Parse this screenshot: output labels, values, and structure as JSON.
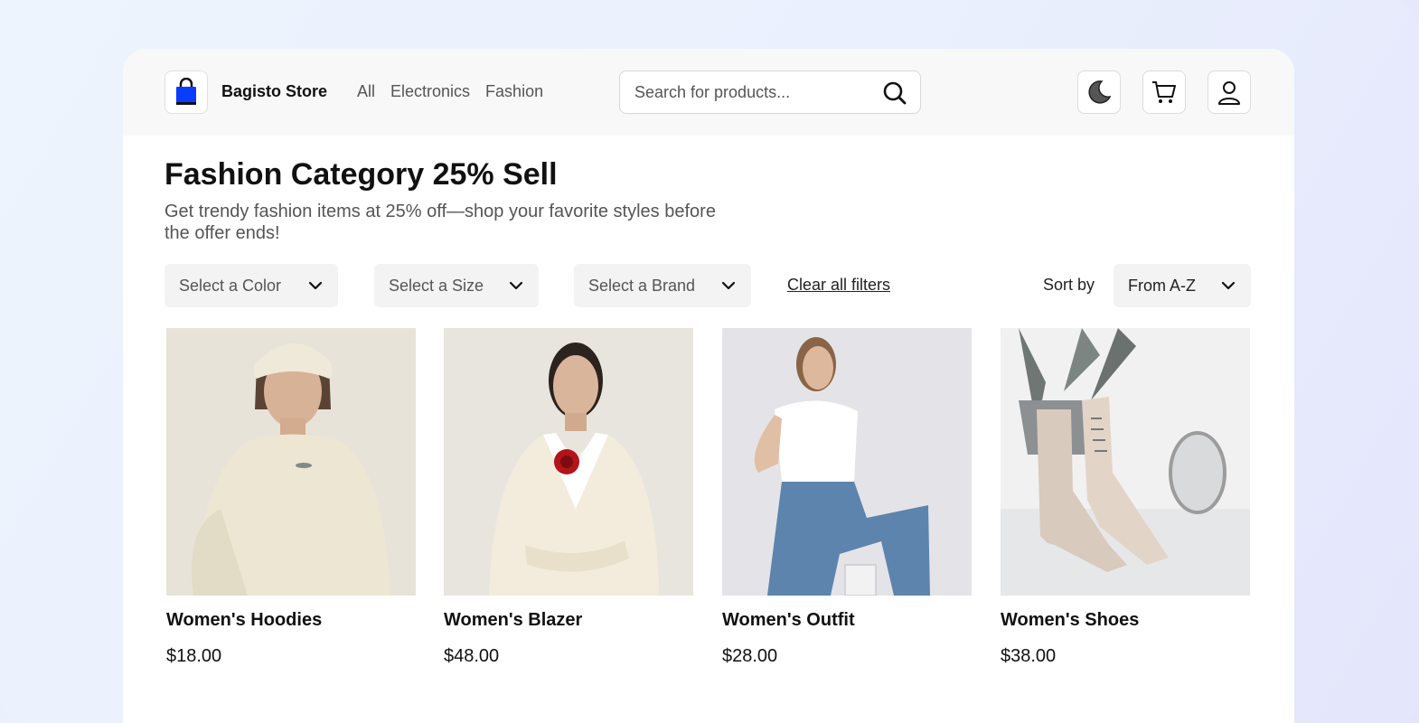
{
  "header": {
    "store_name": "Bagisto Store",
    "nav": [
      "All",
      "Electronics",
      "Fashion"
    ],
    "search_placeholder": "Search for products..."
  },
  "page": {
    "title": "Fashion Category 25% Sell",
    "subtitle": "Get trendy fashion items at 25% off—shop your favorite styles before the offer ends!"
  },
  "filters": {
    "color": "Select a Color",
    "size": "Select a Size",
    "brand": "Select a Brand",
    "clear": "Clear all filters",
    "sort_label": "Sort by",
    "sort_value": "From A-Z"
  },
  "products": [
    {
      "name": "Women's Hoodies",
      "price": "$18.00"
    },
    {
      "name": "Women's Blazer",
      "price": "$48.00"
    },
    {
      "name": "Women's Outfit",
      "price": "$28.00"
    },
    {
      "name": "Women's Shoes",
      "price": "$38.00"
    }
  ],
  "colors": {
    "accent": "#0a3cff",
    "header_bg": "#f8f8f8",
    "select_bg": "#f3f3f3"
  }
}
